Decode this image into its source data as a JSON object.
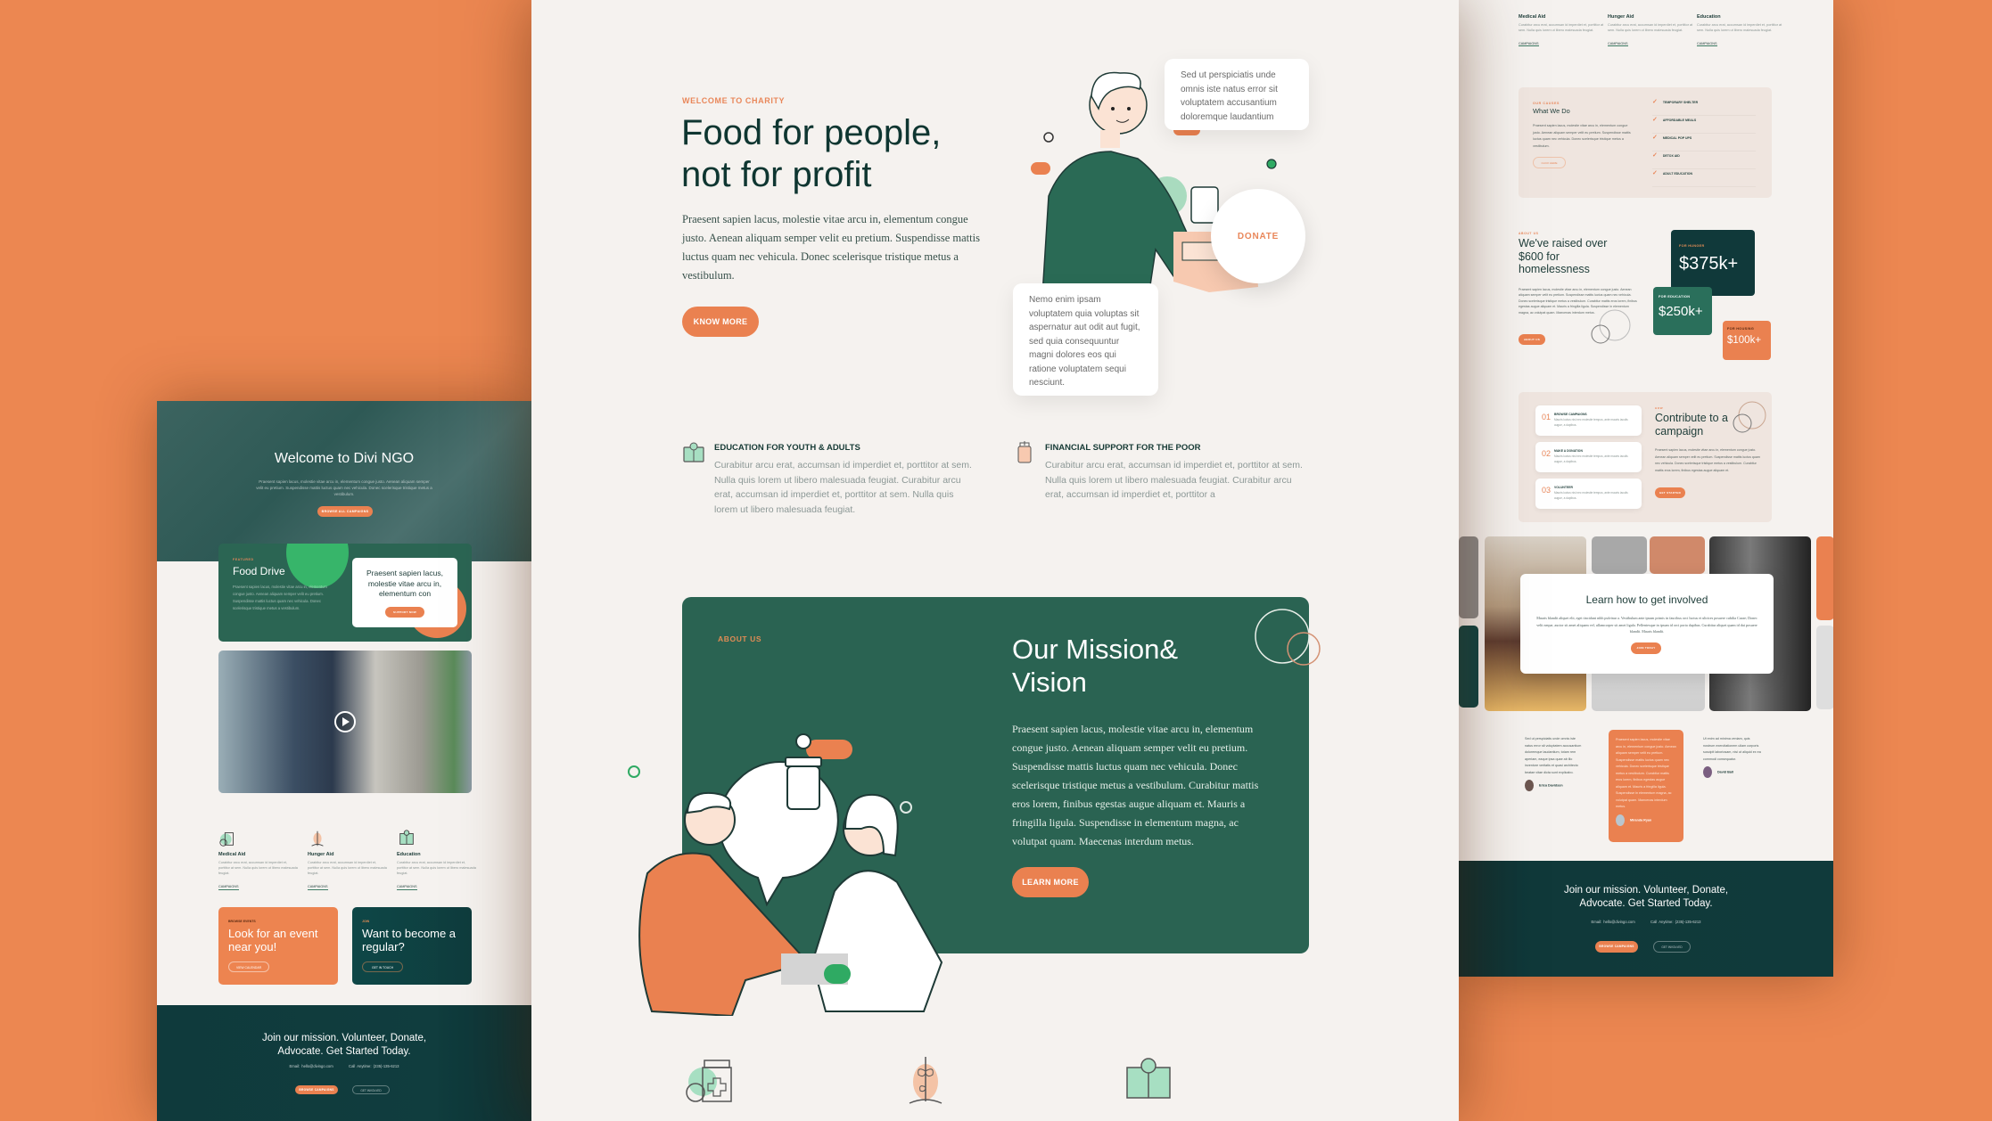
{
  "colors": {
    "background": "#ec8751",
    "accent": "#ea8150",
    "dark_green": "#2a6352",
    "deep_teal": "#10393a",
    "cream": "#f5f2ef"
  },
  "center": {
    "hero": {
      "eyebrow": "WELCOME TO CHARITY",
      "title": "Food for people, not for profit",
      "body": "Praesent sapien lacus, molestie vitae arcu in, elementum congue justo. Aenean aliquam semper velit eu pretium. Suspendisse mattis luctus quam nec vehicula. Donec scelerisque tristique metus a vestibulum.",
      "button": "KNOW MORE",
      "bubble_top": "Sed ut perspiciatis unde omnis iste natus error sit voluptatem accusantium doloremque laudantium",
      "bubble_bottom": "Nemo enim ipsam voluptatem quia voluptas sit aspernatur aut odit aut fugit, sed quia consequuntur magni dolores eos qui ratione voluptatem sequi nesciunt.",
      "donate": "DONATE"
    },
    "features": [
      {
        "icon": "education-book-icon",
        "title": "EDUCATION FOR YOUTH & ADULTS",
        "body": "Curabitur arcu erat, accumsan id imperdiet et, porttitor at sem. Nulla quis lorem ut libero malesuada feugiat. Curabitur arcu erat, accumsan id imperdiet et, porttitor at sem. Nulla quis lorem ut libero malesuada feugiat."
      },
      {
        "icon": "jar-icon",
        "title": "FINANCIAL SUPPORT FOR THE POOR",
        "body": "Curabitur arcu erat, accumsan id imperdiet et, porttitor at sem. Nulla quis lorem ut libero malesuada feugiat. Curabitur arcu erat, accumsan id imperdiet et, porttitor a"
      }
    ],
    "mission": {
      "eyebrow": "ABOUT US",
      "title": "Our Mission& Vision",
      "body": "Praesent sapien lacus, molestie vitae arcu in, elementum congue justo. Aenean aliquam semper velit eu pretium. Suspendisse mattis luctus quam nec vehicula. Donec scelerisque tristique metus a vestibulum. Curabitur mattis eros lorem, finibus egestas augue aliquam et. Mauris a fringilla ligula. Suspendisse in elementum magna, ac volutpat quam. Maecenas interdum metus.",
      "button": "LEARN MORE"
    },
    "bottom_icons": [
      "medicine-bottle-icon",
      "plant-sprout-icon",
      "book-lightbulb-icon"
    ]
  },
  "left": {
    "hero": {
      "title": "Welcome to Divi NGO",
      "body": "Praesent sapien lacus, molestie vitae arcu in, elementum congue justo. Aenean aliquam semper velit eu pretium. Suspendisse mattis luctus quam nec vehicula. Donec scelerisque tristique metus a vestibulum.",
      "button": "BROWSE ALL CAMPAIGNS"
    },
    "food_drive": {
      "eyebrow": "FEATURED",
      "title": "Food Drive",
      "body": "Praesent sapien lacus, molestie vitae arcu in, elementum congue justo. Aenean aliquam semper velit eu pretium. Suspendisse mattis luctus quam nec vehicula. Donec scelerisque tristique metus a vestibulum.",
      "card_text": "Praesent sapien lacus, molestie vitae arcu in, elementum con",
      "card_button": "SUPPORT NOW"
    },
    "services": [
      {
        "icon": "medicine-bottle-icon",
        "title": "Medical Aid",
        "body": "Curabitur arcu erat, accumsan id imperdiet et, porttitor at sem. Nulla quis lorem ut libero malesuada feugiat.",
        "link": "CAMPAIGNS"
      },
      {
        "icon": "plant-sprout-icon",
        "title": "Hunger Aid",
        "body": "Curabitur arcu erat, accumsan id imperdiet et, porttitor at sem. Nulla quis lorem ut libero malesuada feugiat.",
        "link": "CAMPAIGNS"
      },
      {
        "icon": "book-lightbulb-icon",
        "title": "Education",
        "body": "Curabitur arcu erat, accumsan id imperdiet et, porttitor at sem. Nulla quis lorem ut libero malesuada feugiat.",
        "link": "CAMPAIGNS"
      }
    ],
    "cta": [
      {
        "eyebrow": "BROWSE EVENTS",
        "title": "Look for an event near you!",
        "button": "VIEW CALENDAR"
      },
      {
        "eyebrow": "JOIN",
        "title": "Want to become a regular?",
        "button": "GET IN TOUCH"
      }
    ],
    "footer": {
      "title": "Join our mission. Volunteer, Donate, Advocate. Get Started Today.",
      "email": "Email: hello@divingo.com",
      "phone": "Call Anytime: (235)-135-6213",
      "primary": "BROWSE CAMPAIGNS",
      "secondary": "GET INVOLVED"
    }
  },
  "right": {
    "services": [
      {
        "title": "Medical Aid",
        "body": "Curabitur arcu erat, accumsan id imperdiet et, porttitor at sem. Nulla quis lorem ut libero malesuada feugiat.",
        "link": "CAMPAIGNS"
      },
      {
        "title": "Hunger Aid",
        "body": "Curabitur arcu erat, accumsan id imperdiet et, porttitor at sem. Nulla quis lorem ut libero malesuada feugiat.",
        "link": "CAMPAIGNS"
      },
      {
        "title": "Education",
        "body": "Curabitur arcu erat, accumsan id imperdiet et, porttitor at sem. Nulla quis lorem ut libero malesuada feugiat.",
        "link": "CAMPAIGNS"
      }
    ],
    "what_we_do": {
      "eyebrow": "OUR CAUSES",
      "title": "What We Do",
      "body": "Praesent sapien lacus, molestie vitae arcu in, elementum congue justo. Aenean aliquam semper velit eu pretium. Suspendisse mattis luctus quam nec vehicula. Donec scelerisque tristique metus a vestibulum.",
      "button": "CLICK HERE",
      "checklist": [
        "TEMPORARY SHELTER",
        "AFFORDABLE MEALS",
        "MEDICAL POP UPS",
        "DETOX AID",
        "ADULT EDUCATION"
      ]
    },
    "raised": {
      "eyebrow": "ABOUT US",
      "title": "We've raised over $600 for homelessness",
      "body": "Praesent sapien lacus, molestie vitae arcu in, elementum congue justo. Aenean aliquam semper velit eu pretium. Suspendisse mattis luctus quam nec vehicula. Donec scelerisque tristique metus a vestibulum. Curabitur mattis eros lorem, finibus egestas augue aliquam et. Mauris a fringilla ligula. Suspendisse in elementum magna, ac volutpat quam. Maecenas interdum metus.",
      "button": "ABOUT US",
      "stats": [
        {
          "label": "FOR HUNGER",
          "value": "$375k+"
        },
        {
          "label": "FOR EDUCATION",
          "value": "$250k+"
        },
        {
          "label": "FOR HOUSING",
          "value": "$100k+"
        }
      ]
    },
    "contribute": {
      "eyebrow": "HOW",
      "title": "Contribute to a campaign",
      "body": "Praesent sapien lacus, molestie vitae arcu in, elementum congue justo. Aenean aliquam semper velit eu pretium. Suspendisse mattis luctus quam nec vehicula. Donec scelerisque tristique metus a vestibulum. Curabitur mattis eros lorem, finibus egestas augue aliquam et.",
      "button": "GET STARTED",
      "steps": [
        {
          "num": "01",
          "title": "BROWSE CAMPAIGNS",
          "body": "Mauris luctus nisl nec molestie tempus, ante mauris iaculis augue, a dapibus."
        },
        {
          "num": "02",
          "title": "MAKE A DONATION",
          "body": "Mauris luctus nisl nec molestie tempus, ante mauris iaculis augue, a dapibus."
        },
        {
          "num": "03",
          "title": "VOLUNTEER",
          "body": "Mauris luctus nisl nec molestie tempus, ante mauris iaculis augue, a dapibus."
        }
      ]
    },
    "learn": {
      "title": "Learn how to get involved",
      "body": "Mauris blandit aliquet elit, eget tincidunt nibh pulvinar a. Vestibulum ante ipsum primis in faucibus orci luctus et ultrices posuere cubilia Curae; Donec velit neque, auctor sit amet aliquam vel, ullamcorper sit amet ligula. Pellentesque in ipsum id orci porta dapibus. Curabitur aliquet quam id dui posuere blandit. Mauris blandit.",
      "button": "JOIN TODAY"
    },
    "testimonials": [
      {
        "text": "Sed ut perspiciatis unde omnis iste natus error sit voluptatem accusantium doloremque laudantium, totam rem aperiam, eaque ipsa quae ab illo inventore veritatis et quasi architecto beatae vitae dicta sunt explicabo.",
        "name": "Erica Davidson"
      },
      {
        "text": "Praesent sapien lacus, molestie vitae arcu in, elementum congue justo. Aenean aliquam semper velit eu pretium. Suspendisse mattis luctus quam nec vehicula. Donec scelerisque tristique metus a vestibulum. Curabitur mattis eros lorem, finibus egestas augue aliquam et. Mauris a fringilla ligula. Suspendisse in elementum magna, ac volutpat quam. Maecenas interdum metus.",
        "name": "Miranda Ryan"
      },
      {
        "text": "Ut enim ad minima veniam, quis nostrum exercitationem ullam corporis suscipit laboriosam, nisi ut aliquid ex ea commodi consequatur.",
        "name": "David Ball"
      }
    ],
    "footer": {
      "title": "Join our mission. Volunteer, Donate, Advocate. Get Started Today.",
      "email": "Email: hello@divingo.com",
      "phone": "Call Anytime: (235)-135-6213",
      "primary": "BROWSE CAMPAIGNS",
      "secondary": "GET INVOLVED"
    }
  }
}
